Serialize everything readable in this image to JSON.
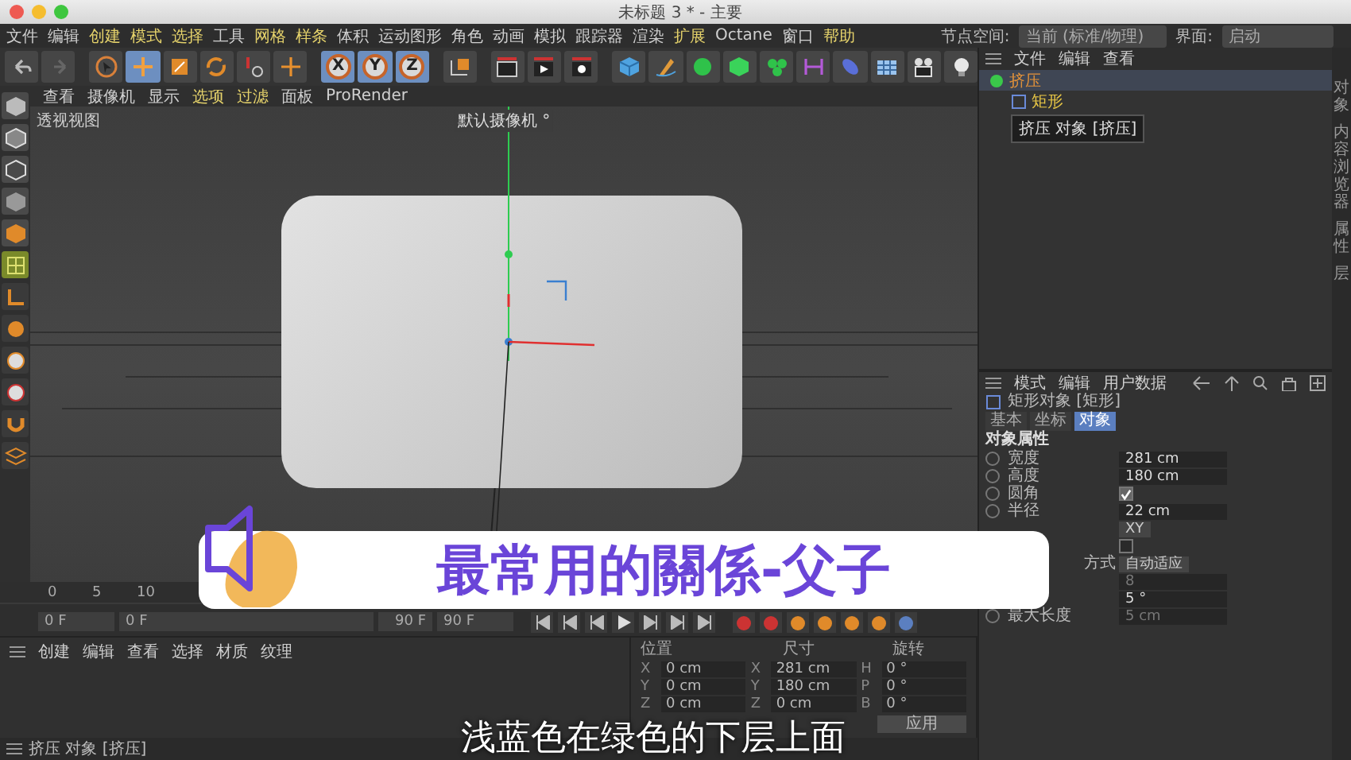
{
  "window": {
    "title": "未标题 3 * - 主要"
  },
  "menu_bar": [
    {
      "label": "文件",
      "highlighted": false
    },
    {
      "label": "编辑",
      "highlighted": false
    },
    {
      "label": "创建",
      "highlighted": true
    },
    {
      "label": "模式",
      "highlighted": true
    },
    {
      "label": "选择",
      "highlighted": true
    },
    {
      "label": "工具",
      "highlighted": false
    },
    {
      "label": "网格",
      "highlighted": true
    },
    {
      "label": "样条",
      "highlighted": true
    },
    {
      "label": "体积",
      "highlighted": false
    },
    {
      "label": "运动图形",
      "highlighted": false
    },
    {
      "label": "角色",
      "highlighted": false
    },
    {
      "label": "动画",
      "highlighted": false
    },
    {
      "label": "模拟",
      "highlighted": false
    },
    {
      "label": "跟踪器",
      "highlighted": false
    },
    {
      "label": "渲染",
      "highlighted": false
    },
    {
      "label": "扩展",
      "highlighted": true
    },
    {
      "label": "Octane",
      "highlighted": false
    },
    {
      "label": "窗口",
      "highlighted": false
    },
    {
      "label": "帮助",
      "highlighted": true
    }
  ],
  "layout_controls": {
    "node_space_label": "节点空间:",
    "node_space_value": "当前 (标准/物理)",
    "interface_label": "界面:",
    "interface_value": "启动"
  },
  "toolbar": {
    "axis_buttons": [
      {
        "label": "X",
        "selected": true
      },
      {
        "label": "Y",
        "selected": true
      },
      {
        "label": "Z",
        "selected": true
      }
    ]
  },
  "viewport": {
    "menu": [
      {
        "label": "查看",
        "highlighted": false
      },
      {
        "label": "摄像机",
        "highlighted": false
      },
      {
        "label": "显示",
        "highlighted": false
      },
      {
        "label": "选项",
        "highlighted": true
      },
      {
        "label": "过滤",
        "highlighted": true
      },
      {
        "label": "面板",
        "highlighted": false
      },
      {
        "label": "ProRender",
        "highlighted": false
      }
    ],
    "view_name": "透视视图",
    "camera": "默认摄像机 °"
  },
  "object_manager": {
    "menu": [
      "文件",
      "编辑",
      "查看"
    ],
    "objects": [
      {
        "name": "挤压",
        "selected": true,
        "children": [
          {
            "name": "矩形",
            "selected": false
          }
        ]
      }
    ],
    "tooltip": "挤压 对象 [挤压]"
  },
  "attributes": {
    "menu": [
      "模式",
      "编辑",
      "用户数据"
    ],
    "object_title": "矩形对象 [矩形]",
    "tabs": [
      {
        "label": "基本",
        "selected": false
      },
      {
        "label": "坐标",
        "selected": false
      },
      {
        "label": "对象",
        "selected": true
      }
    ],
    "section": "对象属性",
    "fields": [
      {
        "kind": "number",
        "label": "宽度",
        "value": "281 cm",
        "disabled": false,
        "keyframed": false
      },
      {
        "kind": "number",
        "label": "高度",
        "value": "180 cm",
        "disabled": false,
        "keyframed": false
      },
      {
        "kind": "checkbox",
        "label": "圆角",
        "checked": true,
        "keyframed": false
      },
      {
        "kind": "number",
        "label": "半径",
        "value": "22 cm",
        "disabled": false,
        "keyframed": false
      },
      {
        "kind": "dropdown",
        "value": "XY"
      },
      {
        "kind": "checkbox",
        "checked": false
      },
      {
        "kind": "dropdown",
        "label": "方式",
        "value": "自动适应"
      },
      {
        "kind": "number",
        "value": "8",
        "disabled": true
      },
      {
        "kind": "number",
        "value": "5 °",
        "disabled": false
      },
      {
        "kind": "number",
        "label": "最大长度",
        "value": "5 cm",
        "disabled": true,
        "keyframed": false
      }
    ]
  },
  "side_tabs": [
    "对象",
    "内容浏览器",
    "属性",
    "层"
  ],
  "timeline": {
    "ruler": [
      "0",
      "5",
      "10"
    ],
    "frame_fields": [
      "0 F",
      "0 F",
      "90 F",
      "90 F"
    ]
  },
  "material_manager": {
    "menu": [
      "创建",
      "编辑",
      "查看",
      "选择",
      "材质",
      "纹理"
    ]
  },
  "coordinates": {
    "headers": [
      "位置",
      "尺寸",
      "旋转"
    ],
    "rows": [
      {
        "axis": "X",
        "position": "0 cm",
        "size_axis": "X",
        "size": "281 cm",
        "rotation_axis": "H",
        "rotation": "0 °"
      },
      {
        "axis": "Y",
        "position": "0 cm",
        "size_axis": "Y",
        "size": "180 cm",
        "rotation_axis": "P",
        "rotation": "0 °"
      },
      {
        "axis": "Z",
        "position": "0 cm",
        "size_axis": "Z",
        "size": "0 cm",
        "rotation_axis": "B",
        "rotation": "0 °"
      }
    ],
    "apply": "应用"
  },
  "status_bar": "挤压 对象 [挤压]",
  "banner": {
    "title": "最常用的關係-父子"
  },
  "subtitle": "浅蓝色在绿色的下层上面"
}
